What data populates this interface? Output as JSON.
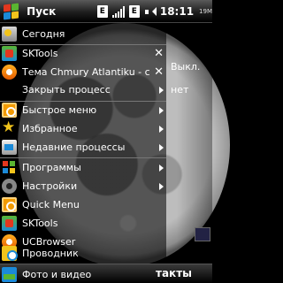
{
  "titlebar": {
    "title": "Пуск",
    "status_e": "E",
    "status_e2": "E",
    "time": "18:11",
    "ram": "19M"
  },
  "background": {
    "right_label_1": "Выкл.",
    "right_label_2": "нет",
    "softkey_right": "такты"
  },
  "menu": {
    "items": [
      {
        "label": "Сегодня",
        "icon": "today-icon"
      },
      {
        "label": "SKTools",
        "icon": "sktools-icon"
      },
      {
        "label": "Тема Chmury Atlantiku - c",
        "icon": "uc-theme-icon"
      },
      {
        "label": "Закрыть процесс"
      },
      {
        "label": "Быстрое меню",
        "icon": "quick-menu-icon"
      },
      {
        "label": "Избранное",
        "icon": "star-icon"
      },
      {
        "label": "Недавние процессы",
        "icon": "recent-icon"
      },
      {
        "label": "Программы",
        "icon": "programs-icon"
      },
      {
        "label": "Настройки",
        "icon": "settings-icon"
      },
      {
        "label": "Quick Menu",
        "icon": "quick-menu-icon"
      },
      {
        "label": "SKTools",
        "icon": "sktools-icon"
      },
      {
        "label": "UCBrowser",
        "icon": "ucbrowser-icon"
      },
      {
        "label": "Проводник",
        "icon": "explorer-icon"
      },
      {
        "label": "Фото и видео",
        "icon": "photo-icon"
      }
    ]
  }
}
